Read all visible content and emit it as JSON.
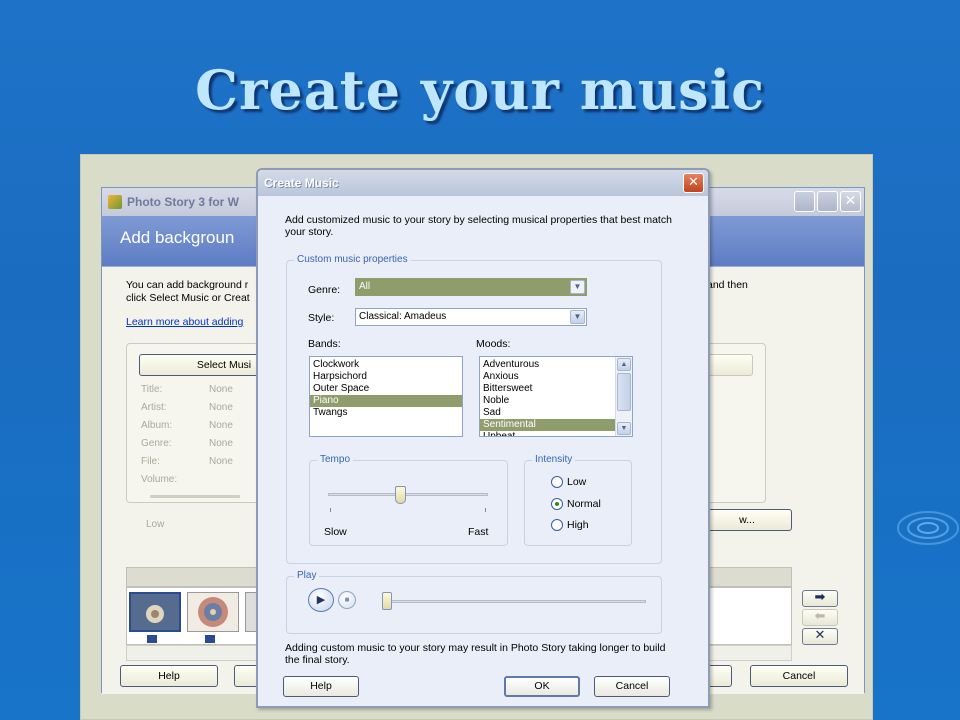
{
  "slide": {
    "title": "Create your music"
  },
  "photostory": {
    "window_title": "Photo Story 3 for W",
    "header": "Add backgroun",
    "description_line1": "You can add background r",
    "description_line2": "click Select Music or Creat",
    "description_right": "and then",
    "learn_link": "Learn more about adding",
    "select_music_button": "Select Musi",
    "properties": [
      {
        "label": "Title:",
        "value": "None"
      },
      {
        "label": "Artist:",
        "value": "None"
      },
      {
        "label": "Album:",
        "value": "None"
      },
      {
        "label": "Genre:",
        "value": "None"
      },
      {
        "label": "File:",
        "value": "None"
      },
      {
        "label": "Volume:",
        "value": ""
      }
    ],
    "volume_low": "Low",
    "create_music_button_partial": "w...",
    "help_button": "Help",
    "cancel_button": "Cancel"
  },
  "dialog": {
    "title": "Create Music",
    "intro": "Add customized music to your story by selecting musical properties that best match your story.",
    "custom_group_label": "Custom music properties",
    "genre_label": "Genre:",
    "genre_value": "All",
    "style_label": "Style:",
    "style_value": "Classical: Amadeus",
    "bands_label": "Bands:",
    "bands": [
      "Clockwork",
      "Harpsichord",
      "Outer Space",
      "Piano",
      "Twangs"
    ],
    "bands_selected": "Piano",
    "moods_label": "Moods:",
    "moods": [
      "Adventurous",
      "Anxious",
      "Bittersweet",
      "Noble",
      "Sad",
      "Sentimental",
      "Upbeat"
    ],
    "moods_selected": "Sentimental",
    "tempo_label": "Tempo",
    "tempo_slow": "Slow",
    "tempo_fast": "Fast",
    "tempo_value_fraction": 0.45,
    "intensity_label": "Intensity",
    "intensity_options": [
      "Low",
      "Normal",
      "High"
    ],
    "intensity_selected": "Normal",
    "play_label": "Play",
    "play_position_fraction": 0.0,
    "note": "Adding custom music to your story may result in Photo Story taking longer to build the final story.",
    "help_button": "Help",
    "ok_button": "OK",
    "cancel_button": "Cancel"
  },
  "colors": {
    "background": "#1a6cc0",
    "title_text": "#bfe6ff",
    "selection": "#8f9c6c",
    "dialog_accent": "#3566b2"
  },
  "icons": {
    "play": "play-icon",
    "stop": "stop-icon",
    "close": "close-icon",
    "dropdown": "chevron-down-icon"
  }
}
